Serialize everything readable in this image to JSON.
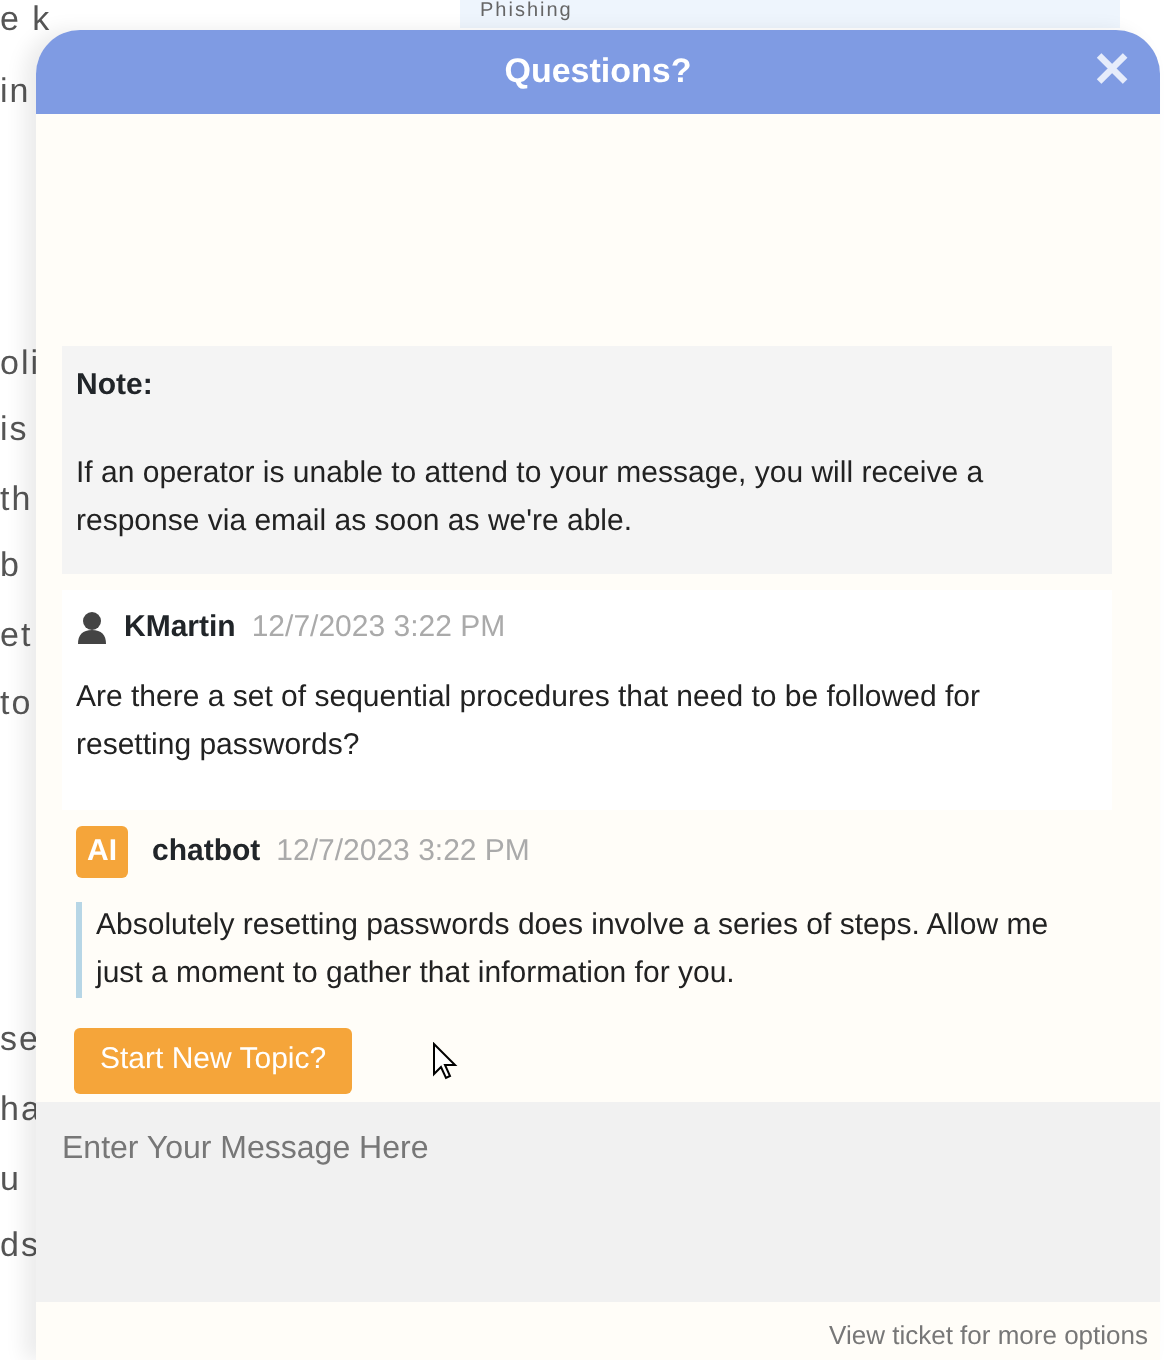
{
  "background_page": {
    "tab_label": "Phishing",
    "text_fragments": [
      "e k",
      "in",
      "oli",
      "is",
      "th",
      "b",
      "et",
      "to",
      "se",
      "ha",
      "u",
      "ds"
    ]
  },
  "chat_window": {
    "title": "Questions?",
    "close_symbol": "✕",
    "note": {
      "heading": "Note:",
      "text": "If an operator is unable to attend to your message, you will receive a response via email as soon as we're able."
    },
    "messages": [
      {
        "kind": "user",
        "author": "KMartin",
        "time": "12/7/2023 3:22 PM",
        "text": "Are there a set of sequential procedures that need to be followed for resetting passwords?"
      },
      {
        "kind": "bot",
        "badge": "AI",
        "author": "chatbot",
        "time": "12/7/2023 3:22 PM",
        "text": "Absolutely resetting passwords does involve a series of steps. Allow me just a moment to gather that information for you."
      }
    ],
    "new_topic_button": "Start New Topic?",
    "message_field": {
      "placeholder": "Enter Your Message Here"
    },
    "footer_link": "View ticket for more options"
  }
}
